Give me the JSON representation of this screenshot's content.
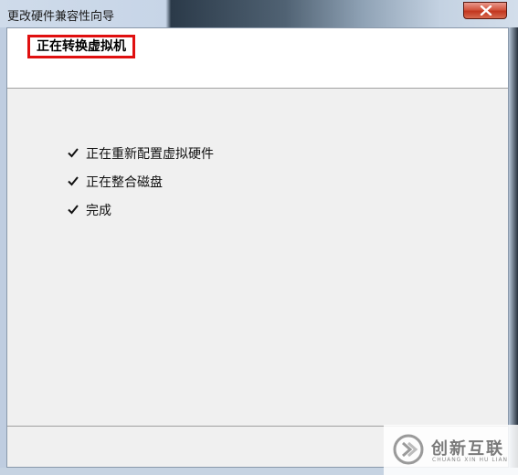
{
  "window": {
    "title": "更改硬件兼容性向导"
  },
  "header": {
    "title": "正在转换虚拟机"
  },
  "steps": [
    {
      "label": "正在重新配置虚拟硬件",
      "status": "done",
      "icon": "checkmark-icon"
    },
    {
      "label": "正在整合磁盘",
      "status": "done",
      "icon": "checkmark-icon"
    },
    {
      "label": "完成",
      "status": "done",
      "icon": "checkmark-icon"
    }
  ],
  "watermark": {
    "text": "创新互联",
    "subtext": "CHUANG XIN HU LIAN"
  },
  "colors": {
    "highlight_box": "#e01010",
    "close_button": "#c2361f"
  }
}
